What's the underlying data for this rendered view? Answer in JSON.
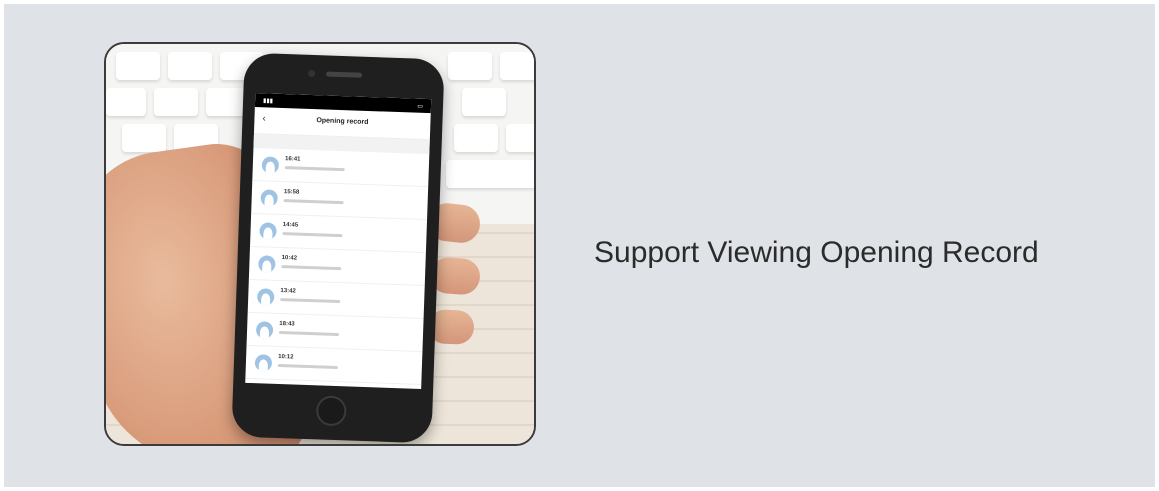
{
  "headline": "Support Viewing Opening Record",
  "colors": {
    "panel_background": "#dfe3e7",
    "avatar": "#9fc4e3",
    "phone_body": "#1f1f1f"
  },
  "phone": {
    "nav_title": "Opening record",
    "back_icon": "chevron-left-icon",
    "records": [
      {
        "time": "16:41"
      },
      {
        "time": "15:58"
      },
      {
        "time": "14:45"
      },
      {
        "time": "10:42"
      },
      {
        "time": "13:42"
      },
      {
        "time": "18:43"
      },
      {
        "time": "10:12"
      }
    ]
  }
}
